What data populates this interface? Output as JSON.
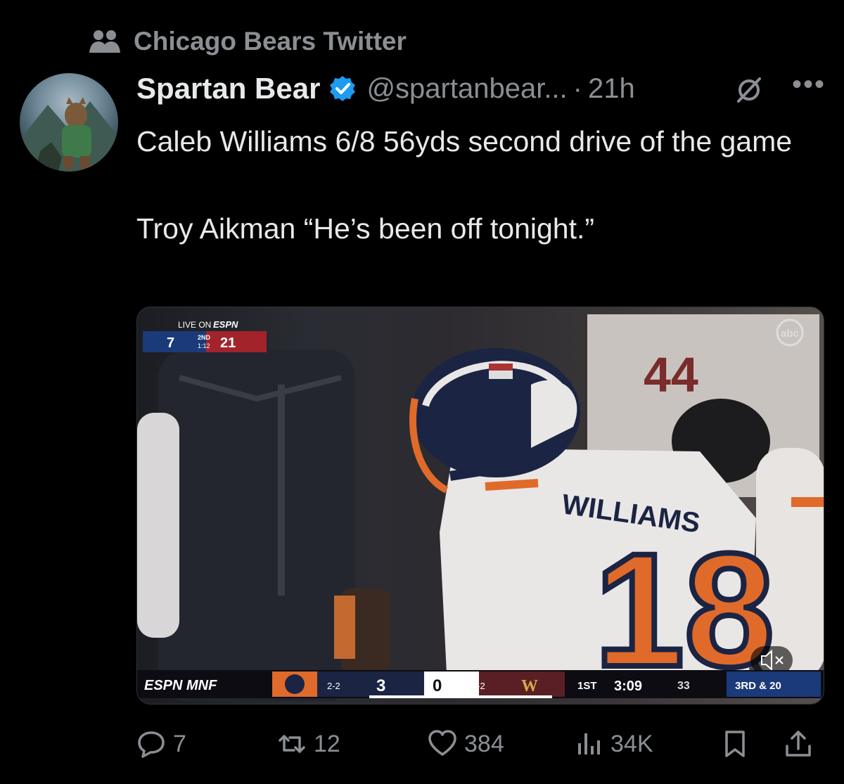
{
  "community": {
    "label": "Chicago Bears Twitter",
    "icon": "people-icon"
  },
  "author": {
    "name": "Spartan Bear",
    "handle": "@spartanbear...",
    "separator": "·",
    "time": "21h",
    "verified": true
  },
  "tweet": {
    "text": "Caleb Williams 6/8 56yds second drive of the game\n\nTroy Aikman “He’s been off tonight.”"
  },
  "media": {
    "top_bug": {
      "live_on": "LIVE ON",
      "network": "ESPN",
      "away_score": "7",
      "quarter": "2ND",
      "clock": "1:12",
      "home_score": "21"
    },
    "corner_logo": "abc",
    "jersey_name": "WILLIAMS",
    "jersey_number": "18",
    "scorebar": {
      "brand": "ESPN MNF",
      "team1_record": "2-2",
      "team1_score": "3",
      "team2_score": "0",
      "team2_record": "3-2",
      "quarter": "1ST",
      "clock": "3:09",
      "play_clock": "33",
      "down": "3RD & 20"
    },
    "mute_icon": "mute-icon"
  },
  "actions": {
    "replies": "7",
    "reposts": "12",
    "likes": "384",
    "views": "34K"
  },
  "colors": {
    "accent": "#1d9bf0",
    "secondary_text": "#8b8f94",
    "bears_orange": "#e06a2a",
    "bears_navy": "#1b2443"
  }
}
